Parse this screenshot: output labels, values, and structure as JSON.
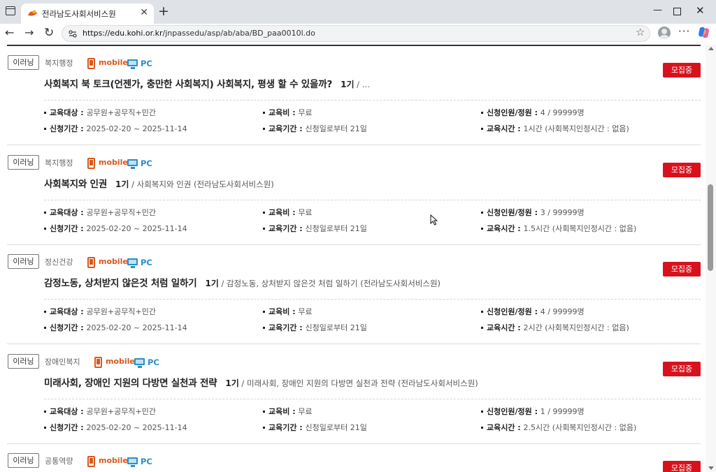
{
  "browser": {
    "tab_title": "전라남도사회서비스원",
    "url_domain": "https://edu.kohi.or.kr",
    "url_path": "/jnpassedu/asp/ab/aba/BD_paa0010l.do"
  },
  "labels": {
    "target": "교육대상 : ",
    "fee": "교육비 : ",
    "capacity": "신청인원/정원 : ",
    "apply_period": "신청기간 : ",
    "edu_period": "교육기간 : ",
    "edu_time": "교육시간 : ",
    "mobile": "mobile",
    "pc": "PC"
  },
  "courses": [
    {
      "type": "이러닝",
      "category": "복지행정",
      "title": "사회복지 북 토크(언젠가, 충만한 사회복지) 사회복지, 평생 할 수 있을까?",
      "gi": "1기",
      "subtitle": " / …",
      "status": "모집중",
      "target": "공무원+공무직+민간",
      "fee": "무료",
      "capacity": "4 / 99999명",
      "apply_period": "2025-02-20 ~ 2025-11-14",
      "edu_period": "신청일로부터 21일",
      "edu_time": "1시간 (사회복지인정시간 : 없음)"
    },
    {
      "type": "이러닝",
      "category": "복지행정",
      "title": "사회복지와 인권",
      "gi": "1기",
      "subtitle": " / 사회복지와 인권 (전라남도사회서비스원)",
      "status": "모집중",
      "target": "공무원+공무직+민간",
      "fee": "무료",
      "capacity": "3 / 99999명",
      "apply_period": "2025-02-20 ~ 2025-11-14",
      "edu_period": "신청일로부터 21일",
      "edu_time": "1.5시간 (사회복지인정시간 : 없음)"
    },
    {
      "type": "이러닝",
      "category": "정신건강",
      "title": "감정노동, 상처받지 않은것 처럼 일하기",
      "gi": "1기",
      "subtitle": " / 감정노동, 상처받지 않은것 처럼 일하기 (전라남도사회서비스원)",
      "status": "모집중",
      "target": "공무원+공무직+민간",
      "fee": "무료",
      "capacity": "4 / 99999명",
      "apply_period": "2025-02-20 ~ 2025-11-14",
      "edu_period": "신청일로부터 21일",
      "edu_time": "2시간 (사회복지인정시간 : 없음)"
    },
    {
      "type": "이러닝",
      "category": "장애인복지",
      "title": "미래사회, 장애인 지원의 다방면 실천과 전략",
      "gi": "1기",
      "subtitle": " / 미래사회, 장애인 지원의 다방면 실천과 전략 (전라남도사회서비스원)",
      "status": "모집중",
      "target": "공무원+공무직+민간",
      "fee": "무료",
      "capacity": "1 / 99999명",
      "apply_period": "2025-02-20 ~ 2025-11-14",
      "edu_period": "신청일로부터 21일",
      "edu_time": "2.5시간 (사회복지인정시간 : 없음)"
    },
    {
      "type": "이러닝",
      "category": "공통역량",
      "status": "모집중"
    }
  ],
  "colors": {
    "status_red": "#d8121c",
    "mobile_orange": "#d9581d",
    "pc_blue": "#2a8fc9"
  }
}
